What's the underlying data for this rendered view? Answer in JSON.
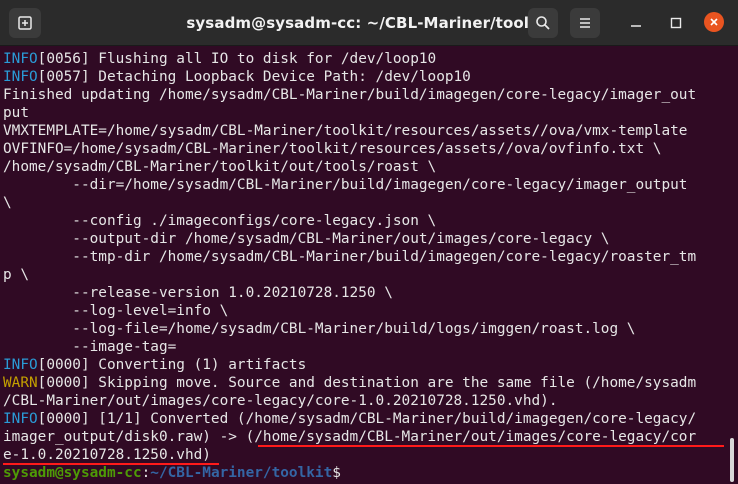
{
  "window": {
    "title": "sysadm@sysadm-cc: ~/CBL-Mariner/toolkit",
    "new_tab_icon": "new-tab-icon",
    "search_icon": "search-icon",
    "menu_icon": "hamburger-menu-icon",
    "close_color": "#e95420"
  },
  "colors": {
    "background": "#300a24",
    "text": "#e6e6e6",
    "info": "#2a9bd6",
    "warn": "#c4a000",
    "prompt_user": "#4e9a06",
    "prompt_path": "#3465a4",
    "highlight_underline": "#ff1a1a"
  },
  "terminal": {
    "l1": {
      "tag": "INFO",
      "text": "[0056] Flushing all IO to disk for /dev/loop10"
    },
    "l2": {
      "tag": "INFO",
      "text": "[0057] Detaching Loopback Device Path: /dev/loop10"
    },
    "l3": "Finished updating /home/sysadm/CBL-Mariner/build/imagegen/core-legacy/imager_out",
    "l4": "put",
    "l5": "VMXTEMPLATE=/home/sysadm/CBL-Mariner/toolkit/resources/assets//ova/vmx-template",
    "l6": "OVFINFO=/home/sysadm/CBL-Mariner/toolkit/resources/assets//ova/ovfinfo.txt \\",
    "l7": "/home/sysadm/CBL-Mariner/toolkit/out/tools/roast \\",
    "l8": "        --dir=/home/sysadm/CBL-Mariner/build/imagegen/core-legacy/imager_output",
    "l9": "\\",
    "l10": "        --config ./imageconfigs/core-legacy.json \\",
    "l11": "        --output-dir /home/sysadm/CBL-Mariner/out/images/core-legacy \\",
    "l12": "        --tmp-dir /home/sysadm/CBL-Mariner/build/imagegen/core-legacy/roaster_tm",
    "l13": "p \\",
    "l14": "        --release-version 1.0.20210728.1250 \\",
    "l15": "        --log-level=info \\",
    "l16": "        --log-file=/home/sysadm/CBL-Mariner/build/logs/imggen/roast.log \\",
    "l17": "        --image-tag=",
    "l18": {
      "tag": "INFO",
      "text": "[0000] Converting (1) artifacts"
    },
    "l19": {
      "tag": "WARN",
      "text": "[0000] Skipping move. Source and destination are the same file (/home/sysadm"
    },
    "l20": "/CBL-Mariner/out/images/core-legacy/core-1.0.20210728.1250.vhd).",
    "l21": {
      "tag": "INFO",
      "text": "[0000] [1/1] Converted (/home/sysadm/CBL-Mariner/build/imagegen/core-legacy/"
    },
    "l22": "imager_output/disk0.raw) -> (/home/sysadm/CBL-Mariner/out/images/core-legacy/cor",
    "l23": "e-1.0.20210728.1250.vhd)",
    "prompt": {
      "user": "sysadm@sysadm-cc",
      "sep": ":",
      "path": "~/CBL-Mariner/toolkit",
      "symbol": "$"
    }
  }
}
